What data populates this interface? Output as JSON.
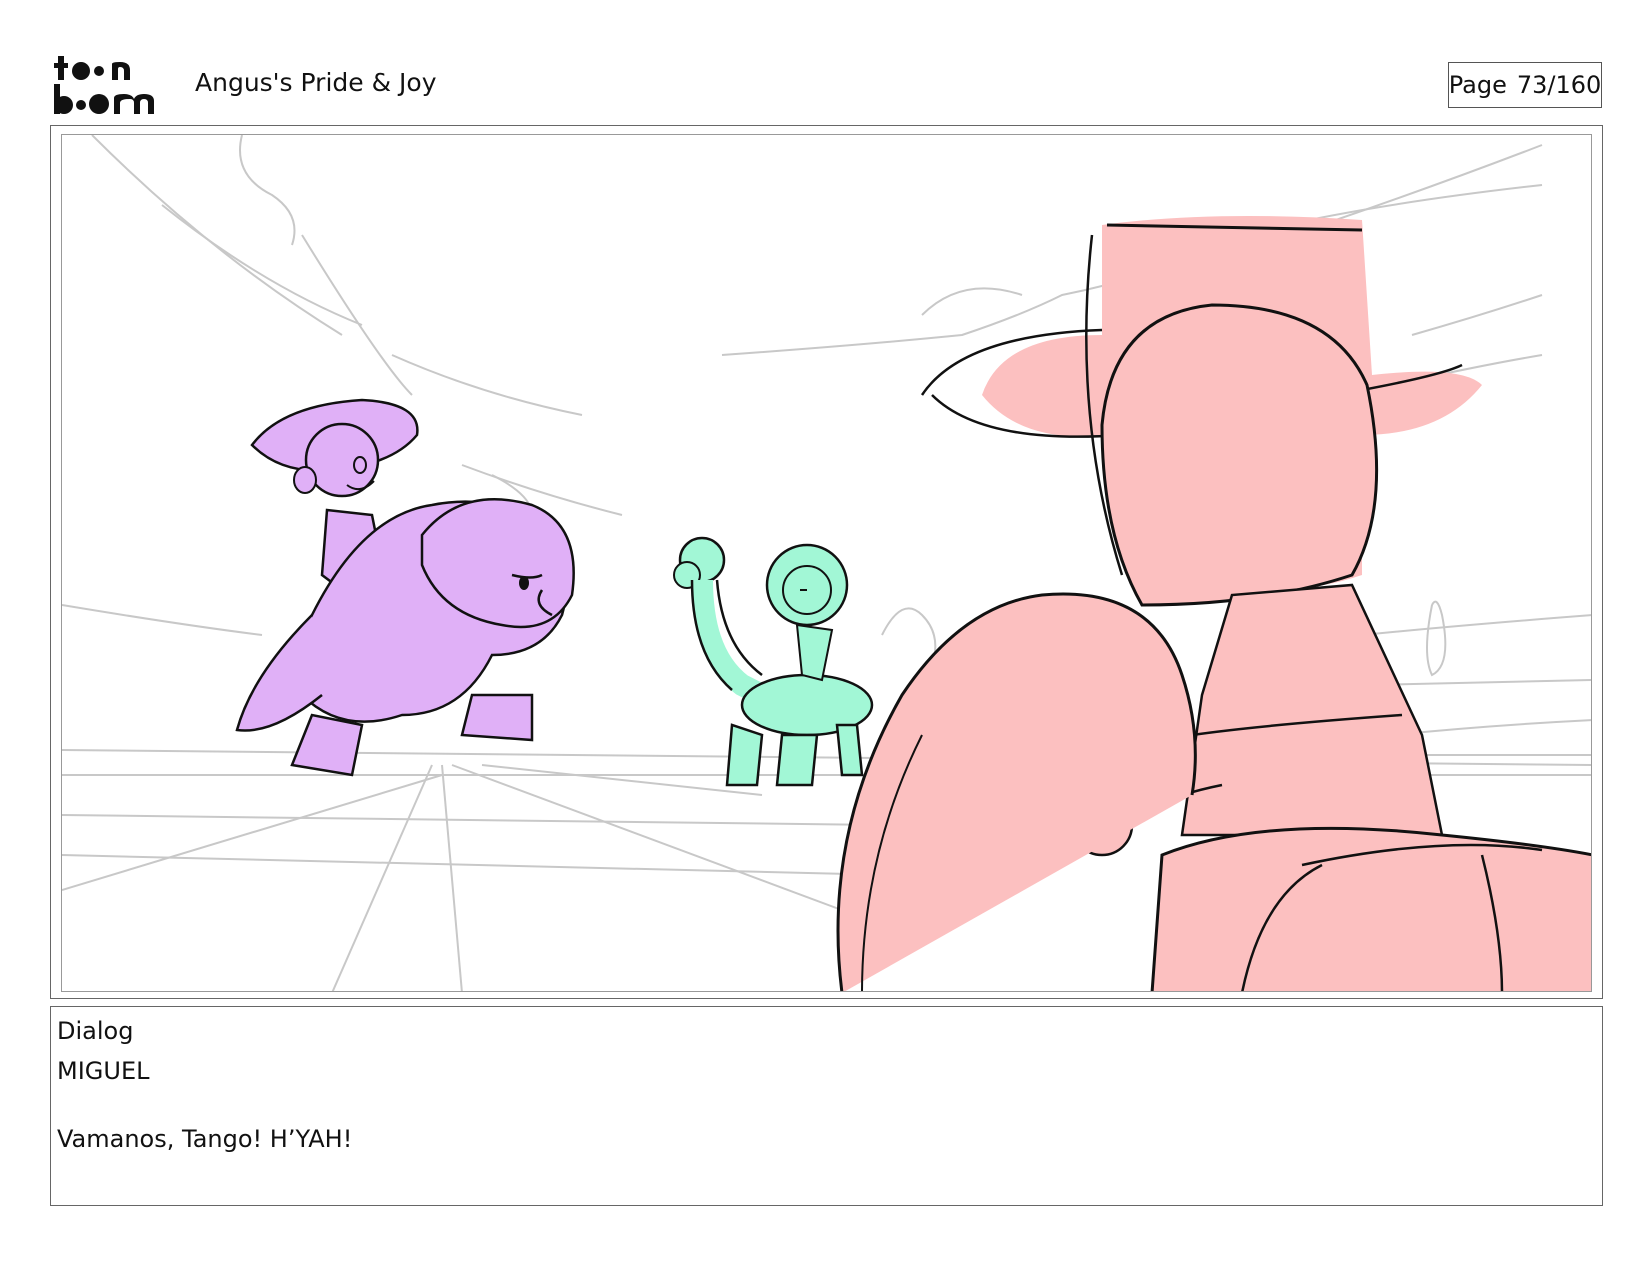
{
  "header": {
    "logo_alt": "toon boom",
    "project_title": "Angus's Pride & Joy",
    "page_label": "Page",
    "page_number": "73/160"
  },
  "panel": {
    "colors": {
      "purple_character": "#e0b0f7",
      "green_character": "#a2f7d6",
      "pink_character": "#fcc0c0",
      "sketch_gray": "#c8c8c8",
      "ink": "#111111"
    }
  },
  "dialog": {
    "header": "Dialog",
    "speaker": "MIGUEL",
    "line": "Vamanos, Tango! H’YAH!"
  }
}
